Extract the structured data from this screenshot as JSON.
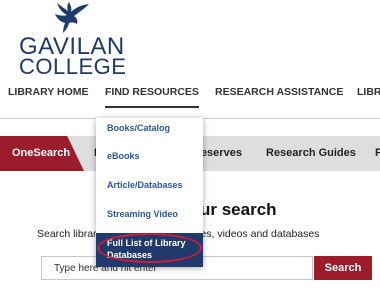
{
  "logo": {
    "line1": "GAVILAN",
    "line2": "COLLEGE"
  },
  "nav": {
    "home": "LIBRARY HOME",
    "find": "FIND RESOURCES",
    "research": "RESEARCH ASSISTANCE",
    "cutoff": "LIBR"
  },
  "tabs": {
    "onesearch": "OneSearch",
    "t2": "B",
    "reserves": "Reserves",
    "guides": "Research Guides",
    "t5": "F"
  },
  "search": {
    "headline": "ur search",
    "subline": "Search library books, ebooks, articles, videos and databases",
    "placeholder": "Type here and hit enter",
    "button": "Search"
  },
  "dropdown": {
    "items": [
      "Books/Catalog",
      "eBooks",
      "Article/Databases",
      "Streaming Video",
      "Full List of Library Databases"
    ]
  },
  "colors": {
    "brand_navy": "#1f3a6b",
    "brand_red": "#9b1c2b",
    "link_blue": "#2b56a8",
    "annotation_red": "#d11b3a"
  }
}
